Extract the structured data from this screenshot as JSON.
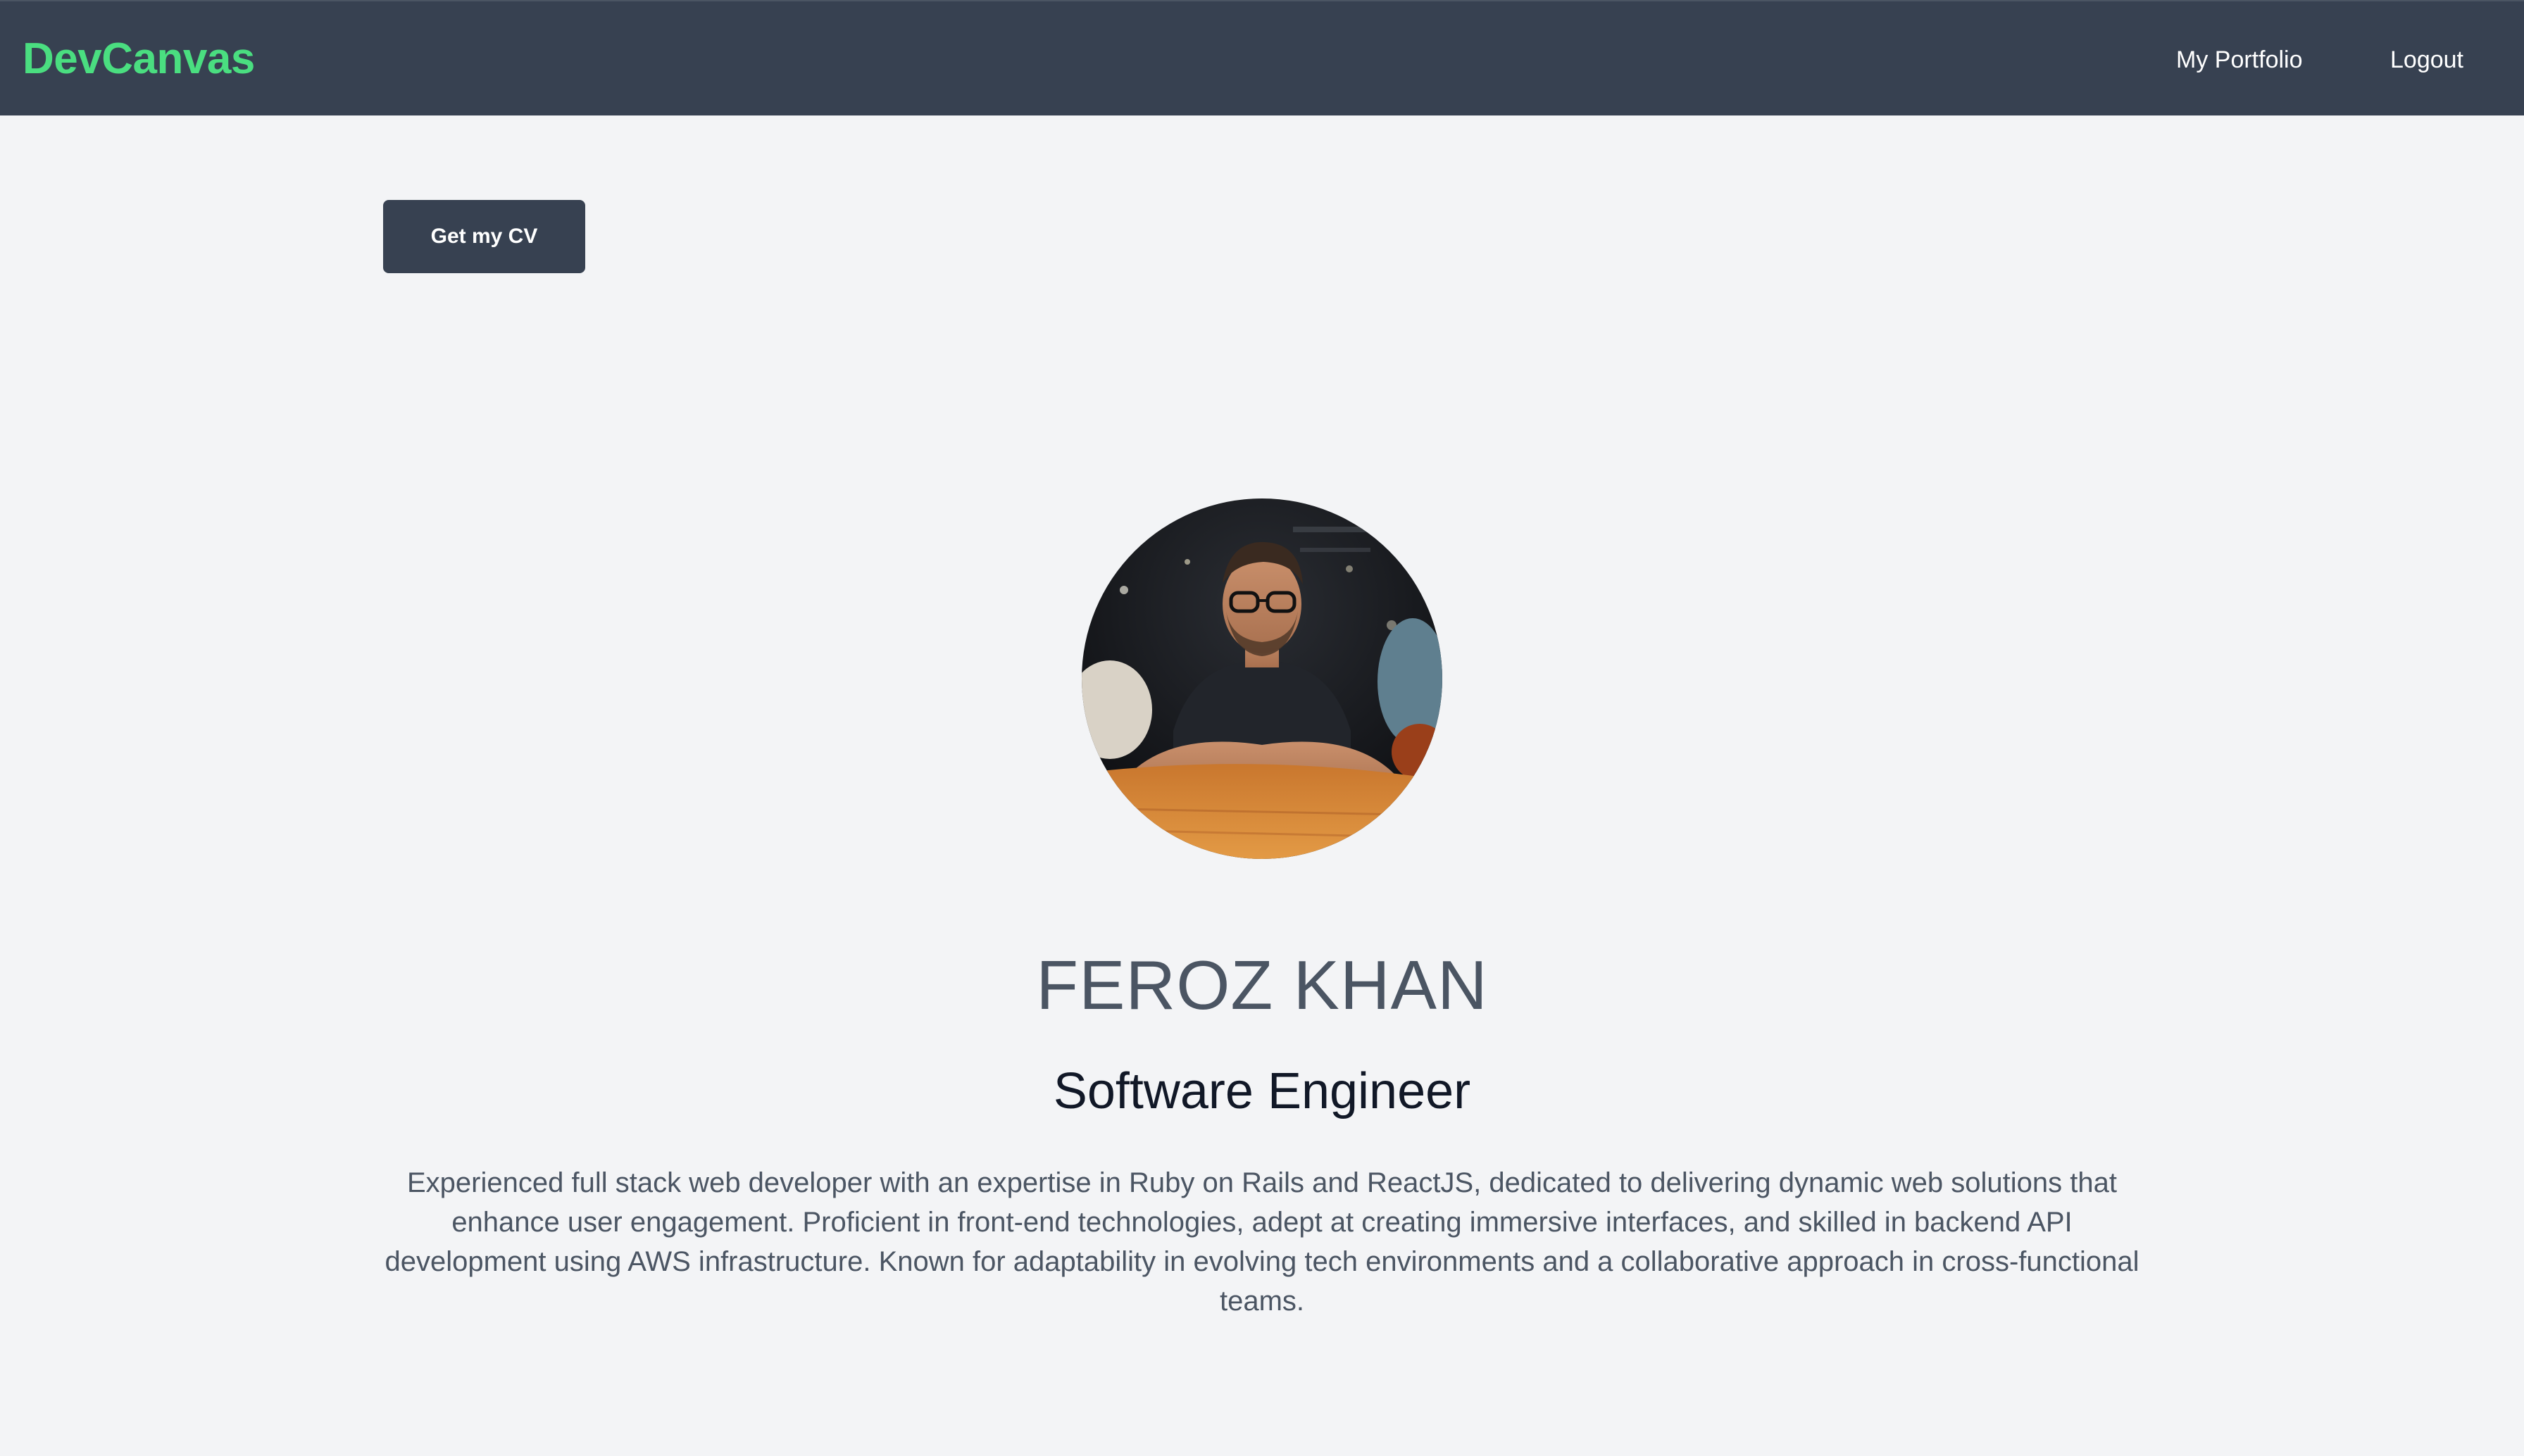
{
  "navbar": {
    "brand": "DevCanvas",
    "links": [
      {
        "label": "My Portfolio"
      },
      {
        "label": "Logout"
      }
    ]
  },
  "actions": {
    "cv_button_label": "Get my CV"
  },
  "profile": {
    "name": "FEROZ KHAN",
    "title": "Software Engineer",
    "bio": "Experienced full stack web developer with an expertise in Ruby on Rails and ReactJS, dedicated to delivering dynamic web solutions that enhance user engagement. Proficient in front-end technologies, adept at creating immersive interfaces, and skilled in backend API development using AWS infrastructure. Known for adaptability in evolving tech environments and a collaborative approach in cross-functional teams."
  },
  "colors": {
    "navbar_bg": "#374151",
    "brand": "#4ade80",
    "page_bg": "#f3f4f6",
    "button_bg": "#374151"
  }
}
